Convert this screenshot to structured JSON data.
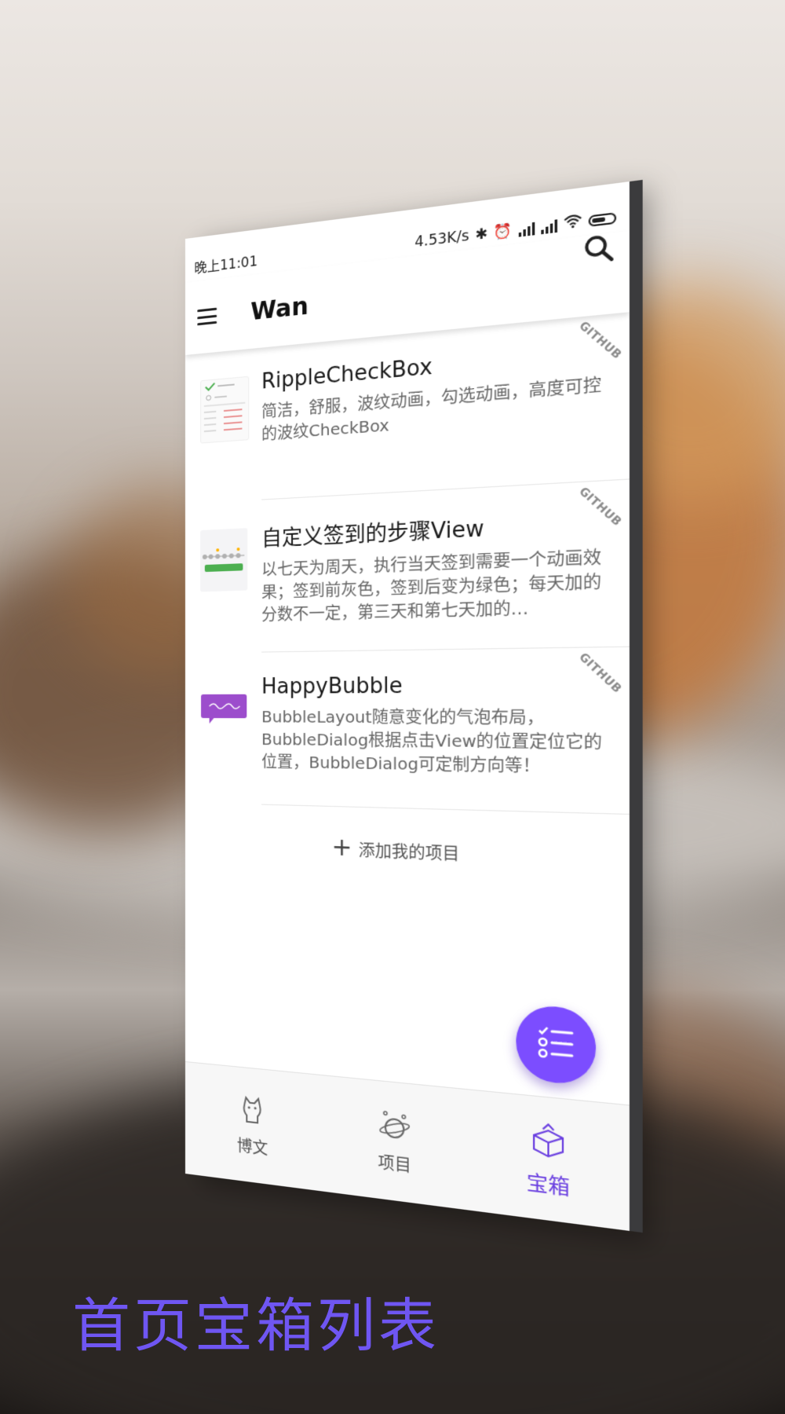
{
  "status_bar": {
    "time": "晚上11:01",
    "speed": "4.53K/s"
  },
  "toolbar": {
    "title": "Wan"
  },
  "projects": [
    {
      "title": "RippleCheckBox",
      "description": "简洁，舒服，波纹动画，勾选动画，高度可控的波纹CheckBox",
      "tag": "GITHUB"
    },
    {
      "title": "自定义签到的步骤View",
      "description": "以七天为周天，执行当天签到需要一个动画效果；签到前灰色，签到后变为绿色；每天加的分数不一定，第三天和第七天加的…",
      "tag": "GITHUB"
    },
    {
      "title": "HappyBubble",
      "description": "BubbleLayout随意变化的气泡布局，BubbleDialog根据点击View的位置定位它的位置，BubbleDialog可定制方向等！",
      "tag": "GITHUB"
    }
  ],
  "add_project": {
    "label": "添加我的项目"
  },
  "bottom_nav": [
    {
      "label": "博文",
      "icon": "cat-icon",
      "active": false
    },
    {
      "label": "项目",
      "icon": "planet-icon",
      "active": false
    },
    {
      "label": "宝箱",
      "icon": "treasure-box-icon",
      "active": true
    }
  ],
  "caption": "首页宝箱列表",
  "colors": {
    "accent": "#7c4dff",
    "caption": "#6f56f2"
  }
}
